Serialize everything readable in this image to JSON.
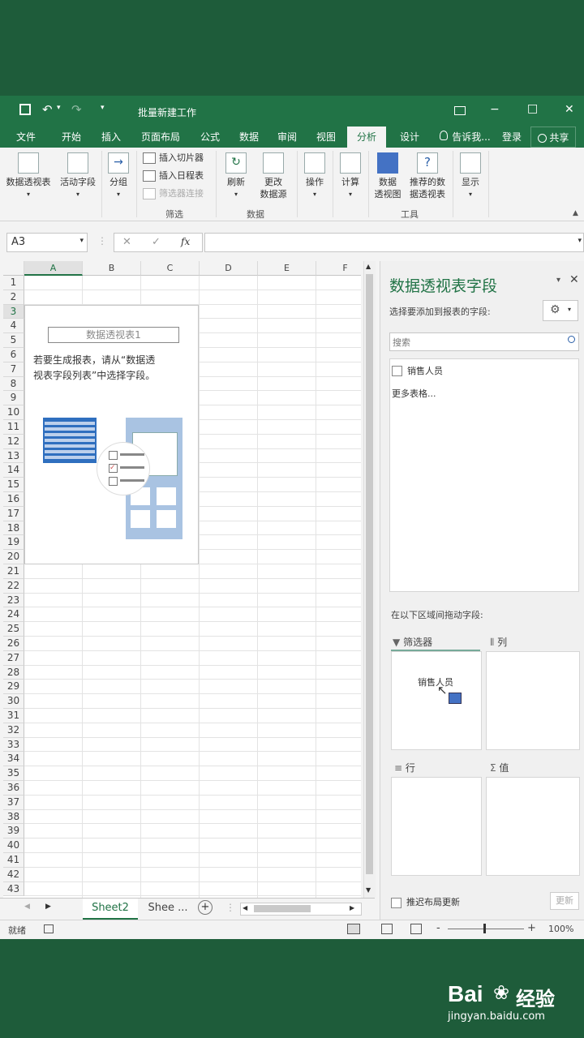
{
  "window": {
    "title": "批量新建工作",
    "help_icon": "window-icon",
    "minimize": "−",
    "maximize": "□",
    "close": "✕"
  },
  "tabs": [
    "文件",
    "开始",
    "插入",
    "页面布局",
    "公式",
    "数据",
    "审阅",
    "视图",
    "分析",
    "设计"
  ],
  "tell_me": "告诉我...",
  "login": "登录",
  "share": "共享",
  "ribbon": {
    "pivot_table": "数据透视表",
    "active_field": "活动字段",
    "group": "分组",
    "insert_slicer": "插入切片器",
    "insert_timeline": "插入日程表",
    "filter_connections": "筛选器连接",
    "filter_group": "筛选",
    "refresh": "刷新",
    "change_source_1": "更改",
    "change_source_2": "数据源",
    "data_group": "数据",
    "actions": "操作",
    "calculations": "计算",
    "pivot_chart_1": "数据",
    "pivot_chart_2": "透视图",
    "recommended_1": "推荐的数",
    "recommended_2": "据透视表",
    "tools_group": "工具",
    "show": "显示"
  },
  "formula_bar": {
    "name_box": "A3",
    "cancel": "✕",
    "enter": "✓",
    "fx": "fx",
    "formula": ""
  },
  "grid": {
    "columns": [
      "A",
      "B",
      "C",
      "D",
      "E",
      "F"
    ],
    "rows": [
      "1",
      "2",
      "3",
      "4",
      "5",
      "6",
      "7",
      "8",
      "9",
      "10",
      "11",
      "12",
      "13",
      "14",
      "15",
      "16",
      "17",
      "18",
      "19",
      "20",
      "21",
      "22",
      "23",
      "24",
      "25",
      "26",
      "27",
      "28",
      "29",
      "30",
      "31",
      "32",
      "33",
      "34",
      "35",
      "36",
      "37",
      "38",
      "39",
      "40",
      "41",
      "42",
      "43"
    ]
  },
  "pivot_placeholder": {
    "name": "数据透视表1",
    "hint_line1": "若要生成报表，请从“数据透",
    "hint_line2": "视表字段列表”中选择字段。"
  },
  "sheet_tabs": {
    "active": "Sheet2",
    "other": "Shee ...",
    "add": "+"
  },
  "status_bar": {
    "ready": "就绪",
    "zoom": "100%",
    "minus": "-",
    "plus": "+"
  },
  "field_pane": {
    "title": "数据透视表字段",
    "choose_label": "选择要添加到报表的字段:",
    "search_placeholder": "搜索",
    "fields": [
      "销售人员"
    ],
    "more_tables": "更多表格...",
    "drag_label": "在以下区域间拖动字段:",
    "filters": "筛选器",
    "columns": "列",
    "rows": "行",
    "values": "值",
    "filter_item": "销售人员",
    "defer_update": "推迟布局更新",
    "update_btn": "更新"
  },
  "watermark": {
    "brand_1": "Bai",
    "brand_2": "经验",
    "url": "jingyan.baidu.com"
  },
  "colors": {
    "excel_green": "#217346",
    "background": "#1e5c3a"
  }
}
